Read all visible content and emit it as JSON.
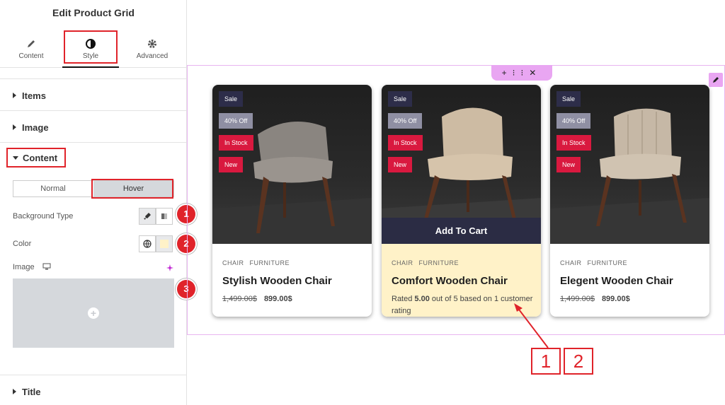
{
  "panel": {
    "title": "Edit Product Grid",
    "tabs": [
      {
        "label": "Content",
        "icon": "pencil-icon"
      },
      {
        "label": "Style",
        "icon": "contrast-icon"
      },
      {
        "label": "Advanced",
        "icon": "gear-icon"
      }
    ],
    "sections": {
      "items": "Items",
      "image": "Image",
      "content": "Content",
      "title": "Title"
    },
    "state_toggle": {
      "normal": "Normal",
      "hover": "Hover"
    },
    "controls": {
      "background_type": "Background Type",
      "color": "Color",
      "image": "Image"
    },
    "badges": [
      "1",
      "2",
      "3"
    ]
  },
  "canvas": {
    "handle_icons": [
      "plus-icon",
      "grid-icon",
      "close-icon"
    ],
    "products": [
      {
        "tags": [
          "Sale",
          "40% Off",
          "In Stock",
          "New"
        ],
        "categories": [
          "CHAIR",
          "FURNITURE"
        ],
        "title": "Stylish Wooden Chair",
        "old_price": "1,499.00$",
        "price": "899.00$"
      },
      {
        "tags": [
          "Sale",
          "40% Off",
          "In Stock",
          "New"
        ],
        "categories": [
          "CHAIR",
          "FURNITURE"
        ],
        "title": "Comfort Wooden Chair",
        "add_to_cart": "Add To Cart",
        "rating_prefix": "Rated ",
        "rating_value": "5.00",
        "rating_suffix": " out of 5 based on 1 customer rating"
      },
      {
        "tags": [
          "Sale",
          "40% Off",
          "In Stock",
          "New"
        ],
        "categories": [
          "CHAIR",
          "FURNITURE"
        ],
        "title": "Elegent Wooden Chair",
        "old_price": "1,499.00$",
        "price": "899.00$"
      }
    ],
    "callouts": [
      "1",
      "2"
    ]
  },
  "colors": {
    "accent_red": "#e0232a",
    "hover_bg": "#fff2c8",
    "cart_bar": "#2b2c44",
    "editor_pink": "#e9a6f2"
  }
}
